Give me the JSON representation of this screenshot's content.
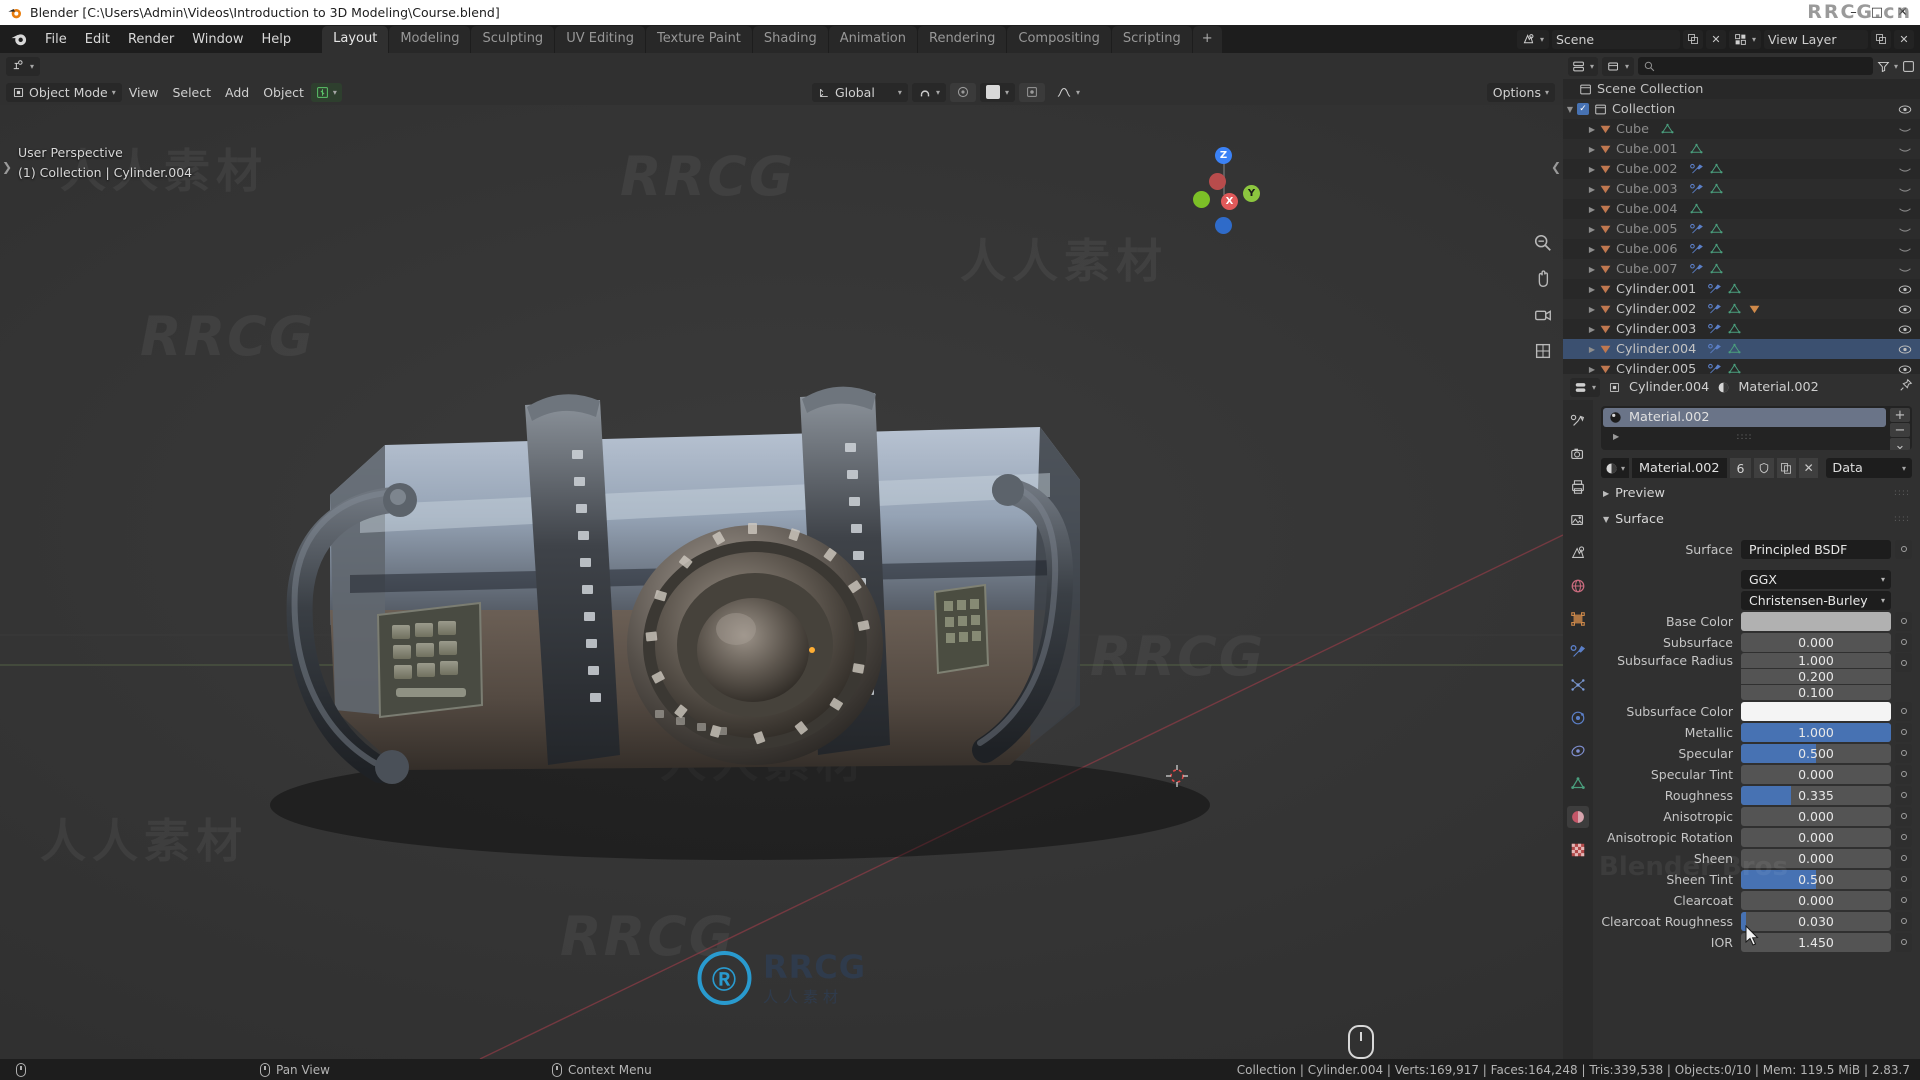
{
  "window": {
    "title": "Blender [C:\\Users\\Admin\\Videos\\Introduction to 3D Modeling\\Course.blend]",
    "minimize": "–",
    "maximize": "□",
    "close": "✕"
  },
  "topbar": {
    "menus": [
      "File",
      "Edit",
      "Render",
      "Window",
      "Help"
    ],
    "workspaces": [
      {
        "label": "Layout",
        "active": true
      },
      {
        "label": "Modeling",
        "active": false
      },
      {
        "label": "Sculpting",
        "active": false
      },
      {
        "label": "UV Editing",
        "active": false
      },
      {
        "label": "Texture Paint",
        "active": false
      },
      {
        "label": "Shading",
        "active": false
      },
      {
        "label": "Animation",
        "active": false
      },
      {
        "label": "Rendering",
        "active": false
      },
      {
        "label": "Compositing",
        "active": false
      },
      {
        "label": "Scripting",
        "active": false
      }
    ],
    "add_workspace": "+",
    "scene_name": "Scene",
    "view_layer_name": "View Layer",
    "new_scene_icon": "new-icon",
    "unlink_scene_icon": "x-icon"
  },
  "viewport": {
    "editor_type_icon": "editor-type-icon",
    "mode": "Object Mode",
    "menus": [
      "View",
      "Select",
      "Add",
      "Object"
    ],
    "transform_orientation": "Global",
    "snap_icon": "magnet-icon",
    "proportional_icon": "proportional-edit-icon",
    "falloff_icon": "falloff-curve-icon",
    "options_label": "Options",
    "overlay_text_line1": "User Perspective",
    "overlay_text_line2": "(1) Collection | Cylinder.004",
    "gizmo_axes": [
      {
        "label": "Z",
        "color": "#3b82f6"
      },
      {
        "label": "Y",
        "color": "#8cc63f"
      },
      {
        "label": "X",
        "color": "#e05a5a"
      }
    ],
    "shading_modes": [
      "wireframe",
      "solid",
      "material-preview",
      "rendered"
    ],
    "active_shading": "material-preview",
    "side_tools": [
      "zoom-icon",
      "pan-hand-icon",
      "camera-view-icon",
      "toggle-ortho-icon"
    ]
  },
  "outliner": {
    "display_mode_icon": "display-mode-icon",
    "filter_icon": "filter-icon",
    "search_placeholder": "",
    "new_collection_icon": "new-collection-icon",
    "root": "Scene Collection",
    "collection": "Collection",
    "items": [
      {
        "name": "Cube",
        "icons": [
          "mesh-data-icon"
        ],
        "visible": false,
        "selected": false,
        "dim": true
      },
      {
        "name": "Cube.001",
        "icons": [
          "mesh-data-icon"
        ],
        "visible": false,
        "selected": false,
        "dim": true
      },
      {
        "name": "Cube.002",
        "icons": [
          "modifier-icon",
          "mesh-data-icon"
        ],
        "visible": false,
        "selected": false,
        "dim": true
      },
      {
        "name": "Cube.003",
        "icons": [
          "modifier-icon",
          "mesh-data-icon"
        ],
        "visible": false,
        "selected": false,
        "dim": true
      },
      {
        "name": "Cube.004",
        "icons": [
          "mesh-data-icon"
        ],
        "visible": false,
        "selected": false,
        "dim": true
      },
      {
        "name": "Cube.005",
        "icons": [
          "modifier-icon",
          "mesh-data-icon"
        ],
        "visible": false,
        "selected": false,
        "dim": true
      },
      {
        "name": "Cube.006",
        "icons": [
          "modifier-icon",
          "mesh-data-icon"
        ],
        "visible": false,
        "selected": false,
        "dim": true
      },
      {
        "name": "Cube.007",
        "icons": [
          "modifier-icon",
          "mesh-data-icon"
        ],
        "visible": false,
        "selected": false,
        "dim": true
      },
      {
        "name": "Cylinder.001",
        "icons": [
          "modifier-icon",
          "mesh-data-icon"
        ],
        "visible": true,
        "selected": false,
        "dim": false
      },
      {
        "name": "Cylinder.002",
        "icons": [
          "modifier-icon",
          "mesh-data-icon",
          "object-icon"
        ],
        "visible": true,
        "selected": false,
        "dim": false
      },
      {
        "name": "Cylinder.003",
        "icons": [
          "modifier-icon",
          "mesh-data-icon"
        ],
        "visible": true,
        "selected": false,
        "dim": false
      },
      {
        "name": "Cylinder.004",
        "icons": [
          "modifier-icon",
          "mesh-data-icon"
        ],
        "visible": true,
        "selected": true,
        "dim": false
      },
      {
        "name": "Cylinder.005",
        "icons": [
          "modifier-icon",
          "mesh-data-icon"
        ],
        "visible": true,
        "selected": false,
        "dim": false
      }
    ]
  },
  "properties": {
    "breadcrumb_object": "Cylinder.004",
    "breadcrumb_material": "Material.002",
    "pin_icon": "pin-icon",
    "material_slot": "Material.002",
    "slot_add": "+",
    "slot_remove": "−",
    "slot_menu": "⌄",
    "material_name": "Material.002",
    "user_count": "6",
    "shield_icon": "fake-user-icon",
    "copy_icon": "new-material-icon",
    "unlink_icon": "✕",
    "data_label": "Data",
    "tabs": [
      {
        "name": "tool-icon",
        "active": false
      },
      {
        "name": "render-icon",
        "active": false
      },
      {
        "name": "output-icon",
        "active": false
      },
      {
        "name": "view-layer-icon",
        "active": false
      },
      {
        "name": "scene-icon",
        "active": false
      },
      {
        "name": "world-icon",
        "active": false
      },
      {
        "name": "object-icon",
        "active": false
      },
      {
        "name": "modifier-icon",
        "active": false
      },
      {
        "name": "particles-icon",
        "active": false
      },
      {
        "name": "physics-icon",
        "active": false
      },
      {
        "name": "constraints-icon",
        "active": false
      },
      {
        "name": "mesh-data-icon",
        "active": false
      },
      {
        "name": "material-icon",
        "active": true
      },
      {
        "name": "texture-icon",
        "active": false
      }
    ],
    "panels": [
      {
        "label": "Preview",
        "open": false
      },
      {
        "label": "Surface",
        "open": true
      }
    ],
    "surface": {
      "surface_label": "Surface",
      "surface_value": "Principled BSDF",
      "distribution": "GGX",
      "subsurface_method": "Christensen-Burley",
      "rows": [
        {
          "label": "Base Color",
          "type": "color",
          "value": "#b1b1b1"
        },
        {
          "label": "Subsurface",
          "type": "slider",
          "value": "0.000",
          "fill": 0
        },
        {
          "label": "Subsurface Radius",
          "type": "stack",
          "values": [
            "1.000",
            "0.200",
            "0.100"
          ]
        },
        {
          "label": "Subsurface Color",
          "type": "color",
          "value": "#f4f4f4"
        },
        {
          "label": "Metallic",
          "type": "slider",
          "value": "1.000",
          "fill": 100
        },
        {
          "label": "Specular",
          "type": "slider",
          "value": "0.500",
          "fill": 50
        },
        {
          "label": "Specular Tint",
          "type": "slider",
          "value": "0.000",
          "fill": 0
        },
        {
          "label": "Roughness",
          "type": "slider",
          "value": "0.335",
          "fill": 33.5
        },
        {
          "label": "Anisotropic",
          "type": "slider",
          "value": "0.000",
          "fill": 0
        },
        {
          "label": "Anisotropic Rotation",
          "type": "slider",
          "value": "0.000",
          "fill": 0
        },
        {
          "label": "Sheen",
          "type": "slider",
          "value": "0.000",
          "fill": 0
        },
        {
          "label": "Sheen Tint",
          "type": "slider",
          "value": "0.500",
          "fill": 50
        },
        {
          "label": "Clearcoat",
          "type": "slider",
          "value": "0.000",
          "fill": 0
        },
        {
          "label": "Clearcoat Roughness",
          "type": "slider",
          "value": "0.030",
          "fill": 3
        },
        {
          "label": "IOR",
          "type": "slider",
          "value": "1.450",
          "fill": 0
        }
      ]
    }
  },
  "statusbar": {
    "left_mouse_icon": "mouse-left-icon",
    "middle_action_icon": "mouse-middle-icon",
    "middle_action": "Pan View",
    "right_action_icon": "mouse-right-icon",
    "right_action": "Context Menu",
    "stats": "Collection | Cylinder.004 | Verts:169,917 | Faces:164,248 | Tris:339,538 | Objects:0/10 | Mem: 119.5 MiB | 2.83.7"
  },
  "watermarks": {
    "cn": "人人素材",
    "rrcg": "RRCG",
    "logo_main": "RRCG",
    "logo_sub": "人人素材",
    "logo_mark": "Ⓡ",
    "corner": "RRCG.cn"
  },
  "colors": {
    "accent": "#4772b3",
    "selected_row": "#3b5070",
    "panel_bg": "#303030",
    "outliner_bg": "#282828",
    "mesh_icon": "#c07850",
    "mesh_data_icon": "#4a9e7d",
    "modifier_icon": "#5b7fc7"
  }
}
